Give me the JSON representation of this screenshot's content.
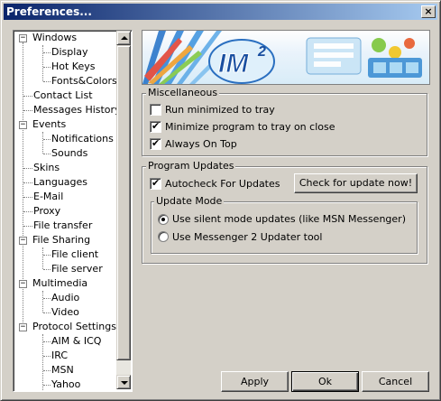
{
  "window": {
    "title": "Preferences...",
    "close_label": "×"
  },
  "tree": {
    "items": [
      {
        "label": "Windows",
        "expander": "−"
      },
      {
        "label": "Display"
      },
      {
        "label": "Hot Keys"
      },
      {
        "label": "Fonts&Colors"
      },
      {
        "label": "Contact List"
      },
      {
        "label": "Messages History"
      },
      {
        "label": "Events",
        "expander": "−"
      },
      {
        "label": "Notifications"
      },
      {
        "label": "Sounds"
      },
      {
        "label": "Skins"
      },
      {
        "label": "Languages"
      },
      {
        "label": "E-Mail"
      },
      {
        "label": "Proxy"
      },
      {
        "label": "File transfer"
      },
      {
        "label": "File Sharing",
        "expander": "−"
      },
      {
        "label": "File client"
      },
      {
        "label": "File server"
      },
      {
        "label": "Multimedia",
        "expander": "−"
      },
      {
        "label": "Audio"
      },
      {
        "label": "Video"
      },
      {
        "label": "Protocol Settings",
        "expander": "−"
      },
      {
        "label": "AIM & ICQ"
      },
      {
        "label": "IRC"
      },
      {
        "label": "MSN"
      },
      {
        "label": "Yahoo"
      }
    ]
  },
  "banner": {
    "logo_text": "IM",
    "logo_superscript": "2"
  },
  "misc": {
    "legend": "Miscellaneous",
    "options": [
      {
        "label": "Run minimized to tray",
        "checked": false
      },
      {
        "label": "Minimize program to tray on close",
        "checked": true
      },
      {
        "label": "Always On Top",
        "checked": true
      }
    ]
  },
  "updates": {
    "legend": "Program Updates",
    "autocheck_label": "Autocheck For Updates",
    "autocheck_checked": true,
    "check_now_label": "Check for update now!",
    "mode_legend": "Update Mode",
    "modes": [
      {
        "label": "Use silent mode updates (like MSN Messenger)",
        "selected": true
      },
      {
        "label": "Use Messenger 2 Updater tool",
        "selected": false
      }
    ]
  },
  "buttons": {
    "apply": "Apply",
    "ok": "Ok",
    "cancel": "Cancel"
  },
  "check_glyph": "✔"
}
